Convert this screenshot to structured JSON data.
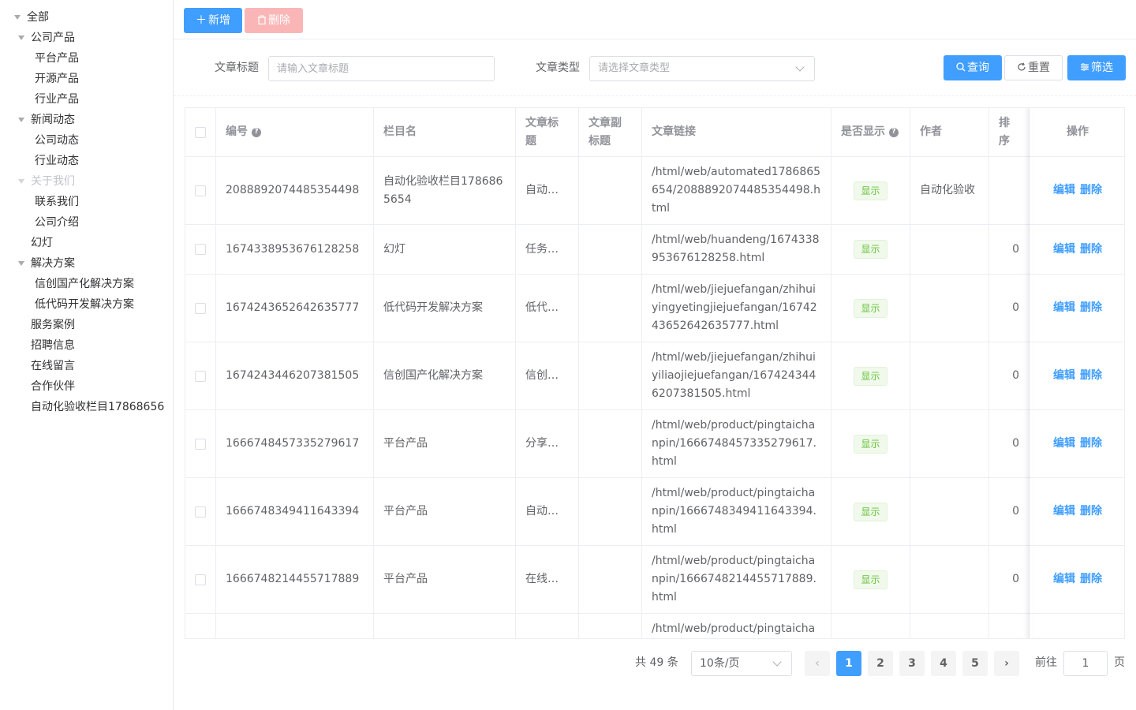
{
  "sidebar": {
    "items": [
      {
        "label": "全部",
        "level": 0,
        "expanded": true
      },
      {
        "label": "公司产品",
        "level": 1,
        "expanded": true
      },
      {
        "label": "平台产品",
        "level": 2
      },
      {
        "label": "开源产品",
        "level": 2
      },
      {
        "label": "行业产品",
        "level": 2
      },
      {
        "label": "新闻动态",
        "level": 1,
        "expanded": true
      },
      {
        "label": "公司动态",
        "level": 2
      },
      {
        "label": "行业动态",
        "level": 2
      },
      {
        "label": "关于我们",
        "level": 1,
        "expanded": true,
        "disabled": true
      },
      {
        "label": "联系我们",
        "level": 2
      },
      {
        "label": "公司介绍",
        "level": 2
      },
      {
        "label": "幻灯",
        "level": 1
      },
      {
        "label": "解决方案",
        "level": 1,
        "expanded": true
      },
      {
        "label": "信创国产化解决方案",
        "level": 2
      },
      {
        "label": "低代码开发解决方案",
        "level": 2
      },
      {
        "label": "服务案例",
        "level": 1
      },
      {
        "label": "招聘信息",
        "level": 1
      },
      {
        "label": "在线留言",
        "level": 1
      },
      {
        "label": "合作伙伴",
        "level": 1
      },
      {
        "label": "自动化验收栏目17868656",
        "level": 1
      }
    ]
  },
  "toolbar": {
    "add_label": "新增",
    "delete_label": "删除"
  },
  "search": {
    "title_label": "文章标题",
    "title_placeholder": "请输入文章标题",
    "type_label": "文章类型",
    "type_placeholder": "请选择文章类型",
    "query_label": "查询",
    "reset_label": "重置",
    "filter_label": "筛选"
  },
  "table": {
    "headers": {
      "id": "编号",
      "column_name": "栏目名",
      "title": "文章标题",
      "subtitle": "文章副标题",
      "link": "文章链接",
      "visible": "是否显示",
      "author": "作者",
      "sort": "排序",
      "actions": "操作"
    },
    "rows": [
      {
        "id": "2088892074485354498",
        "column_name": "自动化验收栏目1786865654",
        "title": "自动化...",
        "subtitle": "",
        "link": "/html/web/automated1786865654/2088892074485354498.html",
        "visible": "显示",
        "author": "自动化验收",
        "sort": "",
        "edit": "编辑",
        "delete": "删除"
      },
      {
        "id": "1674338953676128258",
        "column_name": "幻灯",
        "title": "任务大...",
        "subtitle": "",
        "link": "/html/web/huandeng/1674338953676128258.html",
        "visible": "显示",
        "author": "",
        "sort": "0",
        "edit": "编辑",
        "delete": "删除"
      },
      {
        "id": "1674243652642635777",
        "column_name": "低代码开发解决方案",
        "title": "低代码...",
        "subtitle": "",
        "link": "/html/web/jiejuefangan/zhihuiyingyetingjiejuefangan/1674243652642635777.html",
        "visible": "显示",
        "author": "",
        "sort": "0",
        "edit": "编辑",
        "delete": "删除"
      },
      {
        "id": "1674243446207381505",
        "column_name": "信创国产化解决方案",
        "title": "信创国...",
        "subtitle": "",
        "link": "/html/web/jiejuefangan/zhihuiyiliaojiejuefangan/1674243446207381505.html",
        "visible": "显示",
        "author": "",
        "sort": "0",
        "edit": "编辑",
        "delete": "删除"
      },
      {
        "id": "1666748457335279617",
        "column_name": "平台产品",
        "title": "分享插...",
        "subtitle": "",
        "link": "/html/web/product/pingtaichanpin/1666748457335279617.html",
        "visible": "显示",
        "author": "",
        "sort": "0",
        "edit": "编辑",
        "delete": "删除"
      },
      {
        "id": "1666748349411643394",
        "column_name": "平台产品",
        "title": "自动静...",
        "subtitle": "",
        "link": "/html/web/product/pingtaichanpin/1666748349411643394.html",
        "visible": "显示",
        "author": "",
        "sort": "0",
        "edit": "编辑",
        "delete": "删除"
      },
      {
        "id": "1666748214455717889",
        "column_name": "平台产品",
        "title": "在线留...",
        "subtitle": "",
        "link": "/html/web/product/pingtaichanpin/1666748214455717889.html",
        "visible": "显示",
        "author": "",
        "sort": "0",
        "edit": "编辑",
        "delete": "删除"
      },
      {
        "id": "",
        "column_name": "",
        "title": "",
        "subtitle": "",
        "link": "/html/web/product/pingtaicha",
        "visible": "",
        "author": "",
        "sort": "",
        "edit": "",
        "delete": ""
      }
    ]
  },
  "pagination": {
    "total_text": "共 49 条",
    "page_size": "10条/页",
    "pages": [
      "1",
      "2",
      "3",
      "4",
      "5"
    ],
    "current": "1",
    "goto_label": "前往",
    "goto_value": "1",
    "goto_suffix": "页"
  },
  "colors": {
    "primary": "#409eff",
    "danger_disabled": "#fab6b6",
    "success": "#67c23a",
    "border": "#ebeef5"
  }
}
